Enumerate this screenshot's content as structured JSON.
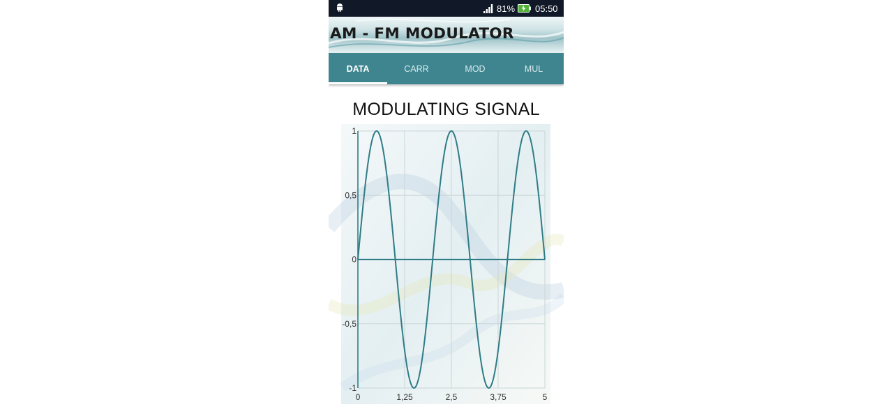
{
  "status_bar": {
    "battery": "81%",
    "time": "05:50",
    "icons": [
      "android-icon",
      "signal-icon",
      "battery-charging-icon"
    ]
  },
  "banner": {
    "title": "AM - FM MODULATOR"
  },
  "tabs": [
    {
      "label": "DATA",
      "active": true
    },
    {
      "label": "CARR",
      "active": false
    },
    {
      "label": "MOD",
      "active": false
    },
    {
      "label": "MUL",
      "active": false
    }
  ],
  "chart_title": "MODULATING SIGNAL",
  "colors": {
    "tab_bar": "#3f8590",
    "curve": "#2f7c86",
    "status_bar": "#111827"
  },
  "chart_data": {
    "type": "line",
    "title": "MODULATING SIGNAL",
    "xlabel": "",
    "ylabel": "",
    "xlim": [
      0,
      5
    ],
    "ylim": [
      -1,
      1
    ],
    "x_ticks": [
      "0",
      "1,25",
      "2,5",
      "3,75",
      "5"
    ],
    "x_tick_values": [
      0,
      1.25,
      2.5,
      3.75,
      5
    ],
    "y_ticks": [
      "1",
      "0,5",
      "0",
      "-0,5",
      "-1"
    ],
    "y_tick_values": [
      1,
      0.5,
      0,
      -0.5,
      -1
    ],
    "grid": true,
    "series": [
      {
        "function": "sine",
        "amplitude": 1,
        "frequency": 0.5,
        "x_range": [
          0,
          5
        ]
      }
    ]
  }
}
